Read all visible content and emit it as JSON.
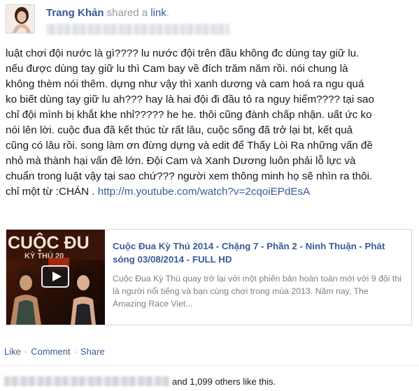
{
  "post": {
    "author": "Trang Khản",
    "shared_text": " shared a ",
    "shared_object": "link",
    "shared_period": ".",
    "body": "luật chơi đội nước là gì???? lu nước đội trên đầu không đc dùng tay giữ lu.\nnếu được dùng tay giữ lu thì Cam bay về đích trăm năm rồi. nói chung là\nkhông thèm nói thêm. dựng như vậy thì xanh dương và cam hoá ra ngu quá\nko biết dùng tay giữ lu ah??? hay là hai đội đi đầu tỏ ra nguy hiểm???? tại sao\nchỉ đội mình bị khắt khe nhỉ????? he he. thôi cũng đành chấp nhận. uất ức ko\nnói lên lời. cuộc đua đã kết thúc từ rất lâu, cuộc sống đã trở lại bt, kết quả\ncũng có lâu rồi. song làm ơn đừng dựng và edit để Thấy Lòi Ra những vấn đề\nnhỏ mà thành hại vấn đề lớn. Đội Cam và Xanh Dương luôn phải lỗ lực và\nchuẩn trong luật vậy tại sao chứ??? người xem thông minh họ sẽ nhìn ra thôi.\nchỉ một từ :CHÁN . ",
    "url": "http://m.youtube.com/watch?v=2cqoiEPdEsA"
  },
  "link_card": {
    "title": "Cuộc Đua Kỳ Thú 2014 - Chặng 7 - Phần 2 - Ninh Thuận - Phát sóng 03/08/2014 - FULL HD",
    "description": "Cuộc Đua Kỳ Thú quay trở lại với một phiên bản hoàn toàn mới với 9 đội thi là người nổi tiếng và bạn cùng chơi trong mùa 2013. Năm nay, The Amazing Race Viet...",
    "thumbnail_text_1": "CUỘC ĐU",
    "thumbnail_text_2": "KỲ THÚ 20"
  },
  "actions": {
    "like": "Like",
    "comment": "Comment",
    "share": "Share",
    "separator": "·"
  },
  "likes": {
    "text": "and 1,099 others like this."
  },
  "colors": {
    "link": "#3b5998",
    "meta": "#9197a3",
    "text": "#141823",
    "border": "#d3d6db"
  }
}
